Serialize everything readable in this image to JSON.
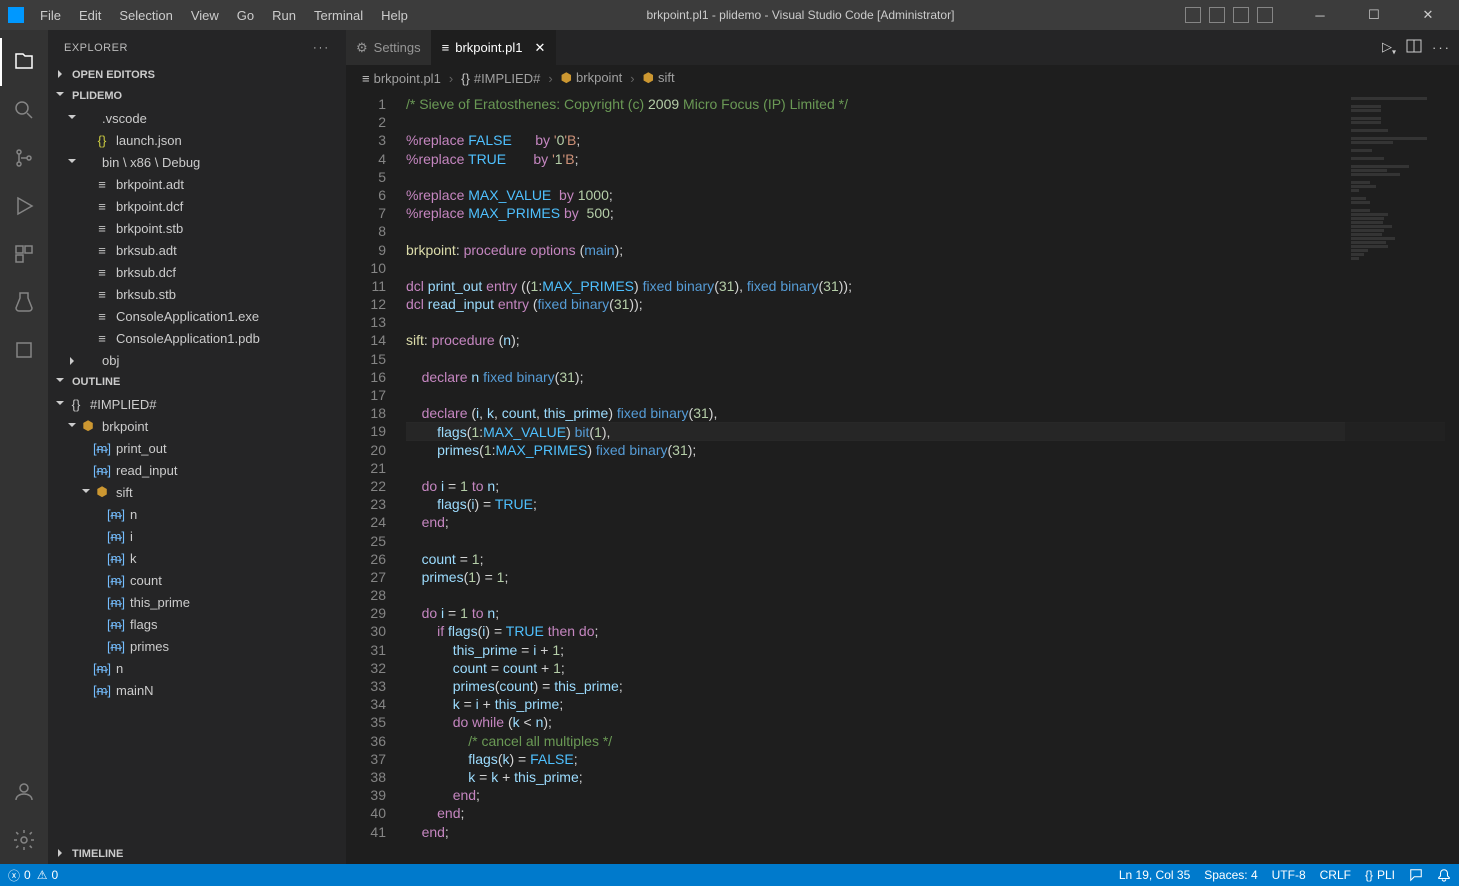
{
  "window": {
    "title": "brkpoint.pl1 - plidemo - Visual Studio Code [Administrator]"
  },
  "menu": [
    "File",
    "Edit",
    "Selection",
    "View",
    "Go",
    "Run",
    "Terminal",
    "Help"
  ],
  "sidebar": {
    "title": "EXPLORER",
    "open_editors": "OPEN EDITORS",
    "project": "PLIDEMO",
    "tree": [
      {
        "l": 1,
        "chev": "down",
        "icon": "",
        "label": ".vscode"
      },
      {
        "l": 2,
        "chev": "",
        "icon": "json",
        "label": "launch.json"
      },
      {
        "l": 1,
        "chev": "down",
        "icon": "",
        "label": "bin \\ x86 \\ Debug"
      },
      {
        "l": 2,
        "chev": "",
        "icon": "file",
        "label": "brkpoint.adt"
      },
      {
        "l": 2,
        "chev": "",
        "icon": "file",
        "label": "brkpoint.dcf"
      },
      {
        "l": 2,
        "chev": "",
        "icon": "file",
        "label": "brkpoint.stb"
      },
      {
        "l": 2,
        "chev": "",
        "icon": "file",
        "label": "brksub.adt"
      },
      {
        "l": 2,
        "chev": "",
        "icon": "file",
        "label": "brksub.dcf"
      },
      {
        "l": 2,
        "chev": "",
        "icon": "file",
        "label": "brksub.stb"
      },
      {
        "l": 2,
        "chev": "",
        "icon": "file",
        "label": "ConsoleApplication1.exe"
      },
      {
        "l": 2,
        "chev": "",
        "icon": "file",
        "label": "ConsoleApplication1.pdb"
      },
      {
        "l": 1,
        "chev": "right",
        "icon": "",
        "label": "obj"
      }
    ],
    "outline_title": "OUTLINE",
    "outline": [
      {
        "l": 0,
        "chev": "down",
        "icon": "struct",
        "label": "#IMPLIED#"
      },
      {
        "l": 1,
        "chev": "down",
        "icon": "label",
        "label": "brkpoint"
      },
      {
        "l": 2,
        "chev": "",
        "icon": "method",
        "label": "print_out"
      },
      {
        "l": 2,
        "chev": "",
        "icon": "method",
        "label": "read_input"
      },
      {
        "l": 2,
        "chev": "down",
        "icon": "label",
        "label": "sift"
      },
      {
        "l": 3,
        "chev": "",
        "icon": "method",
        "label": "n"
      },
      {
        "l": 3,
        "chev": "",
        "icon": "method",
        "label": "i"
      },
      {
        "l": 3,
        "chev": "",
        "icon": "method",
        "label": "k"
      },
      {
        "l": 3,
        "chev": "",
        "icon": "method",
        "label": "count"
      },
      {
        "l": 3,
        "chev": "",
        "icon": "method",
        "label": "this_prime"
      },
      {
        "l": 3,
        "chev": "",
        "icon": "method",
        "label": "flags"
      },
      {
        "l": 3,
        "chev": "",
        "icon": "method",
        "label": "primes"
      },
      {
        "l": 2,
        "chev": "",
        "icon": "method",
        "label": "n"
      },
      {
        "l": 2,
        "chev": "",
        "icon": "method",
        "label": "mainN"
      }
    ],
    "timeline": "TIMELINE"
  },
  "tabs": [
    {
      "icon": "gear",
      "label": "Settings",
      "active": false
    },
    {
      "icon": "file",
      "label": "brkpoint.pl1",
      "active": true
    }
  ],
  "breadcrumb": [
    {
      "icon": "file",
      "label": "brkpoint.pl1"
    },
    {
      "icon": "struct",
      "label": "#IMPLIED#"
    },
    {
      "icon": "label",
      "label": "brkpoint"
    },
    {
      "icon": "label",
      "label": "sift"
    }
  ],
  "code_lines": [
    "/* Sieve of Eratosthenes: Copyright (c) 2009 Micro Focus (IP) Limited */",
    "",
    "%replace FALSE      by '0'B;",
    "%replace TRUE       by '1'B;",
    "",
    "%replace MAX_VALUE  by 1000;",
    "%replace MAX_PRIMES by  500;",
    "",
    "brkpoint: procedure options (main);",
    "",
    "dcl print_out entry ((1:MAX_PRIMES) fixed binary(31), fixed binary(31));",
    "dcl read_input entry (fixed binary(31));",
    "",
    "sift: procedure (n);",
    "",
    "    declare n fixed binary(31);",
    "",
    "    declare (i, k, count, this_prime) fixed binary(31),",
    "        flags(1:MAX_VALUE) bit(1),",
    "        primes(1:MAX_PRIMES) fixed binary(31);",
    "",
    "    do i = 1 to n;",
    "        flags(i) = TRUE;",
    "    end;",
    "",
    "    count = 1;",
    "    primes(1) = 1;",
    "",
    "    do i = 1 to n;",
    "        if flags(i) = TRUE then do;",
    "            this_prime = i + 1;",
    "            count = count + 1;",
    "            primes(count) = this_prime;",
    "            k = i + this_prime;",
    "            do while (k < n);",
    "                /* cancel all multiples */",
    "                flags(k) = FALSE;",
    "                k = k + this_prime;",
    "            end;",
    "        end;",
    "    end;"
  ],
  "highlight_line": 19,
  "status": {
    "errors": "0",
    "warnings": "0",
    "ln_col": "Ln 19, Col 35",
    "spaces": "Spaces: 4",
    "encoding": "UTF-8",
    "eol": "CRLF",
    "lang": "PLI",
    "bell": "notifications"
  }
}
